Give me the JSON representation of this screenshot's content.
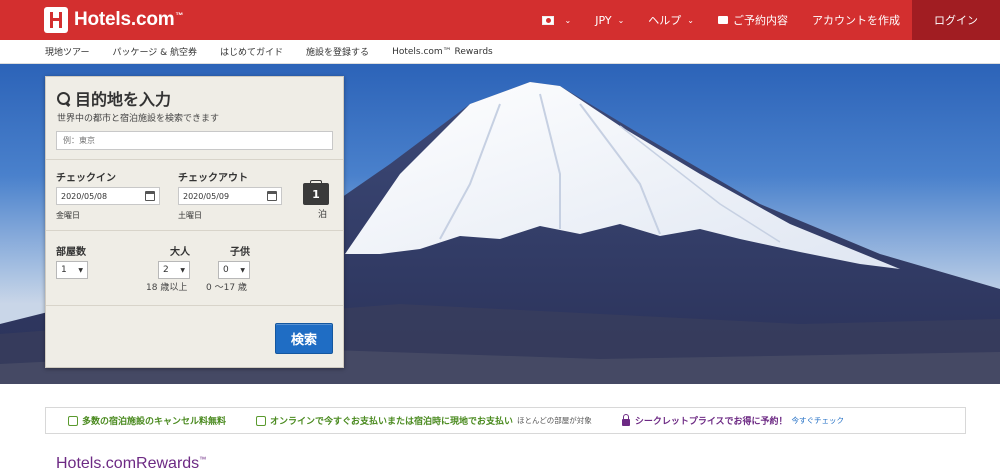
{
  "header": {
    "logo_text": "Hotels.com",
    "logo_tm": "™",
    "currency": "JPY",
    "help": "ヘルプ",
    "reservations": "ご予約内容",
    "create_account": "アカウントを作成",
    "login": "ログイン"
  },
  "subnav": {
    "items": [
      "現地ツアー",
      "パッケージ & 航空券",
      "はじめてガイド",
      "施設を登録する",
      "Hotels.com™ Rewards"
    ]
  },
  "search": {
    "title": "目的地を入力",
    "subtitle": "世界中の都市と宿泊施設を検索できます",
    "destination_placeholder": "例：東京",
    "checkin_label": "チェックイン",
    "checkin_value": "2020/05/08",
    "checkin_dow": "金曜日",
    "checkout_label": "チェックアウト",
    "checkout_value": "2020/05/09",
    "checkout_dow": "土曜日",
    "nights": "1",
    "nights_label": "泊",
    "rooms_label": "部屋数",
    "rooms_value": "1",
    "adults_label": "大人",
    "adults_value": "2",
    "adults_note": "18 歳以上",
    "children_label": "子供",
    "children_value": "0",
    "children_note": "0 〜17 歳",
    "search_button": "検索"
  },
  "benefits": {
    "free_cancel": "多数の宿泊施設のキャンセル料無料",
    "pay_option": "オンラインで今すぐお支払いまたは宿泊時に現地でお支払い",
    "pay_note": "ほとんどの部屋が対象",
    "secret_price": "シークレットプライスでお得に予約！",
    "secret_link": "今すぐチェック"
  },
  "rewards": {
    "logo_a": "Hotels.com",
    "logo_b": "Rewards",
    "tm": "™"
  },
  "colors": {
    "brand_red": "#d32f2f",
    "login_bg": "#a11d22",
    "search_blue": "#1f6dc4",
    "benefit_green": "#4a8a1f",
    "rewards_purple": "#6d2a84"
  }
}
